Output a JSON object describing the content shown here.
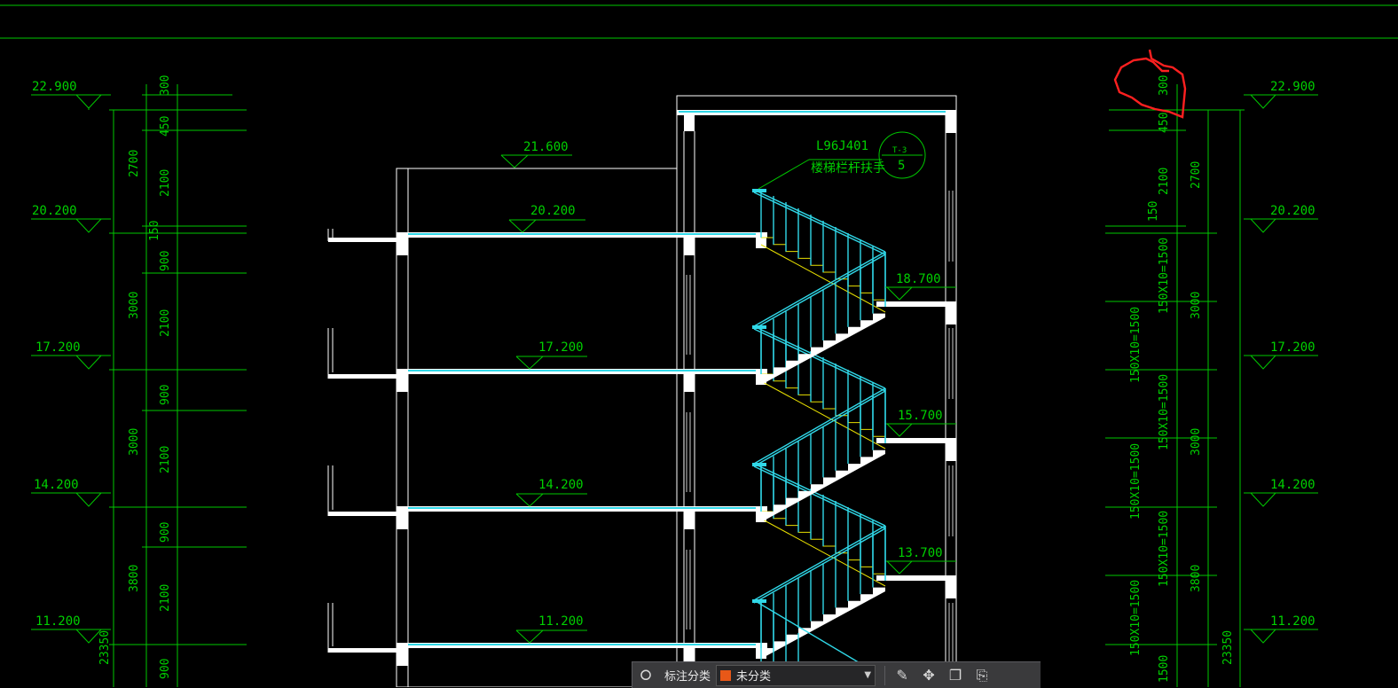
{
  "elevations_left": [
    "22.900",
    "20.200",
    "17.200",
    "14.200",
    "11.200"
  ],
  "elevations_right": [
    "22.900",
    "20.200",
    "17.200",
    "14.200",
    "11.200"
  ],
  "floor_marks": [
    "20.200",
    "17.200",
    "14.200",
    "11.200"
  ],
  "roof_mark": "21.600",
  "landing_marks": [
    "18.700",
    "15.700",
    "13.700"
  ],
  "dims_left_outer": [
    "2700",
    "3000",
    "3000",
    "3800",
    "23350"
  ],
  "dims_left_inner": [
    "300",
    "450",
    "2100",
    "150",
    "900",
    "2100",
    "900",
    "2100",
    "900",
    "2100",
    "900"
  ],
  "dims_right_inner": [
    "300",
    "450",
    "2100",
    "150",
    "150X10=1500",
    "150X10=1500",
    "150X10=1500",
    "150X10=1500",
    "150X10=1500",
    "1500"
  ],
  "dims_right_outer": [
    "2700",
    "3000",
    "3000",
    "3800",
    "23350"
  ],
  "callout": {
    "ref": "L96J401",
    "desc": "楼梯栏杆扶手",
    "sheet": "T-3",
    "number": "5"
  },
  "toolbar": {
    "label": "标注分类",
    "selected": "未分类",
    "swatch_color": "#e85818"
  }
}
